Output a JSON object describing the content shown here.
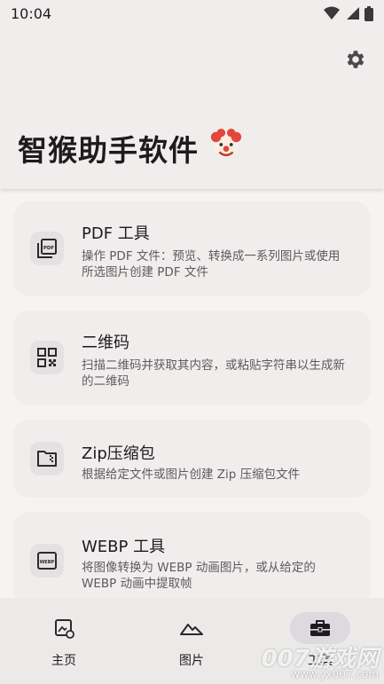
{
  "status_bar": {
    "time": "10:04"
  },
  "header": {
    "title": "智猴助手软件"
  },
  "tools": [
    {
      "title": "PDF 工具",
      "description": "操作 PDF 文件：预览、转换成一系列图片或使用所选图片创建 PDF 文件",
      "icon": "pdf-file-icon"
    },
    {
      "title": "二维码",
      "description": "扫描二维码并获取其内容，或粘贴字符串以生成新的二维码",
      "icon": "qr-code-icon"
    },
    {
      "title": "Zip压缩包",
      "description": "根据给定文件或图片创建 Zip 压缩包文件",
      "icon": "zip-folder-icon"
    },
    {
      "title": "WEBP 工具",
      "description": "将图像转换为 WEBP 动画图片，或从给定的 WEBP 动画中提取帧",
      "icon": "webp-file-icon"
    }
  ],
  "bottom_nav": {
    "items": [
      {
        "label": "主页",
        "icon": "home-image-icon",
        "active": false
      },
      {
        "label": "图片",
        "icon": "landscape-icon",
        "active": false
      },
      {
        "label": "工具",
        "icon": "toolbox-icon",
        "active": true
      }
    ]
  },
  "watermark": {
    "text": "007游戏网",
    "url": "www.yx007.com"
  },
  "colors": {
    "background": "#f6f4f3",
    "card": "#f0eeed",
    "active_pill": "#dcdadf",
    "icon_bg": "#e4e1e3"
  }
}
